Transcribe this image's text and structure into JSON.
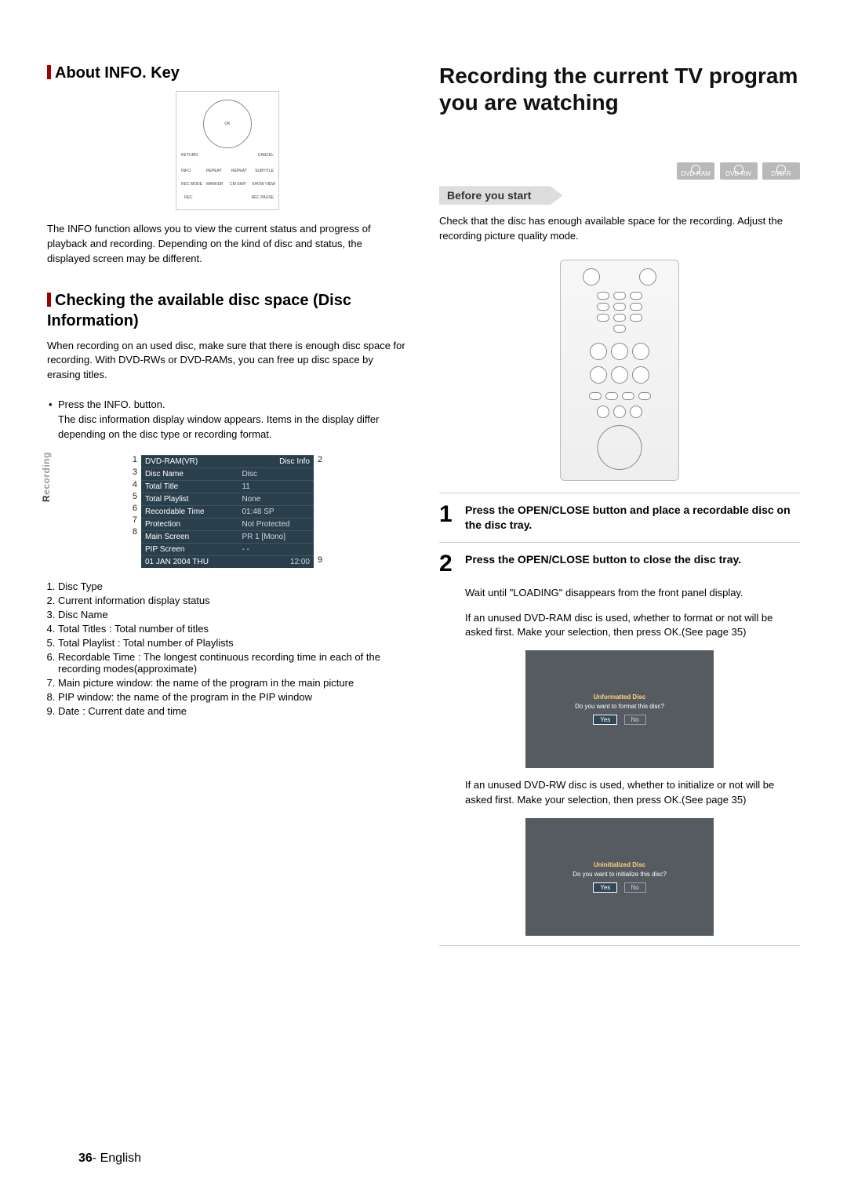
{
  "left": {
    "section1_title": "About INFO. Key",
    "remote_labels": {
      "ok": "OK",
      "return": "RETURN",
      "cancel": "CANCEL",
      "info": "INFO.",
      "repeat1": "REPEAT",
      "repeat2": "REPEAT",
      "subtitle": "SUBTITLE",
      "recmode": "REC MODE",
      "marker": "MARKER",
      "cmskip": "CM SKIP",
      "showview": "SHOW VIEW",
      "rec": "REC",
      "recpause": "REC PAUSE"
    },
    "info_paragraph": "The INFO function allows you to view the current status and progress of playback and recording. Depending on the kind of disc and status, the displayed screen may be different.",
    "section2_title": "Checking the available disc space (Disc Information)",
    "disc_space_paragraph": "When recording on an used disc, make sure that there is enough disc space for recording. With DVD-RWs or DVD-RAMs, you can free up disc space by erasing titles.",
    "press_info": "Press the INFO. button.",
    "press_info_body": "The disc information display window appears. Items in the display differ depending on the disc type or recording format.",
    "disc_table": {
      "header_left": "DVD-RAM(VR)",
      "header_right": "Disc Info",
      "rows": [
        {
          "label": "Disc Name",
          "value": "Disc"
        },
        {
          "label": "Total Title",
          "value": "11"
        },
        {
          "label": "Total Playlist",
          "value": "None"
        },
        {
          "label": "Recordable Time",
          "value": "01:48 SP"
        },
        {
          "label": "Protection",
          "value": "Not Protected"
        },
        {
          "label": "Main Screen",
          "value": "PR 1 [Mono]"
        },
        {
          "label": "PIP Screen",
          "value": "- -"
        }
      ],
      "footer_left": "01 JAN 2004 THU",
      "footer_right": "12:00"
    },
    "callouts_left": [
      "1",
      "3",
      "4",
      "5",
      "6",
      "7",
      "8"
    ],
    "callouts_right": [
      "2",
      "9"
    ],
    "legend": [
      "Disc Type",
      "Current information display status",
      "Disc Name",
      "Total Titles : Total number of titles",
      "Total Playlist : Total number of Playlists",
      "Recordable Time : The longest continuous recording time in each of the recording modes(approximate)",
      "Main picture window: the name of the program in the main picture",
      "PIP window: the name of the program in the PIP window",
      "Date : Current date and time"
    ]
  },
  "right": {
    "main_title": "Recording the current TV program you are watching",
    "badges": [
      "DVD-RAM",
      "DVD-RW",
      "DVD-R"
    ],
    "before_start": "Before you start",
    "before_start_body": "Check that the disc has enough available space for the recording. Adjust the recording picture quality mode.",
    "step1": {
      "num": "1",
      "title": "Press the OPEN/CLOSE button and place a recordable disc on the disc tray."
    },
    "step2": {
      "num": "2",
      "title": "Press the OPEN/CLOSE button to close the disc tray.",
      "body1": "Wait until \"LOADING\" disappears from the front panel display.",
      "body2": "If an unused DVD-RAM disc is used, whether to format or not will be asked first. Make your selection, then press OK.(See page 35)",
      "dialog1": {
        "t1": "Unformatted Disc",
        "t2": "Do you want to format this disc?",
        "yes": "Yes",
        "no": "No"
      },
      "body3": "If an unused DVD-RW disc is used, whether to initialize or not will be asked first. Make your selection, then press OK.(See page 35)",
      "dialog2": {
        "t1": "Uninitialized Disc",
        "t2": "Do you want to initialize this disc?",
        "yes": "Yes",
        "no": "No"
      }
    }
  },
  "side_tab_strong": "R",
  "side_tab_rest": "ecording",
  "page_number": "36",
  "page_lang": "English"
}
